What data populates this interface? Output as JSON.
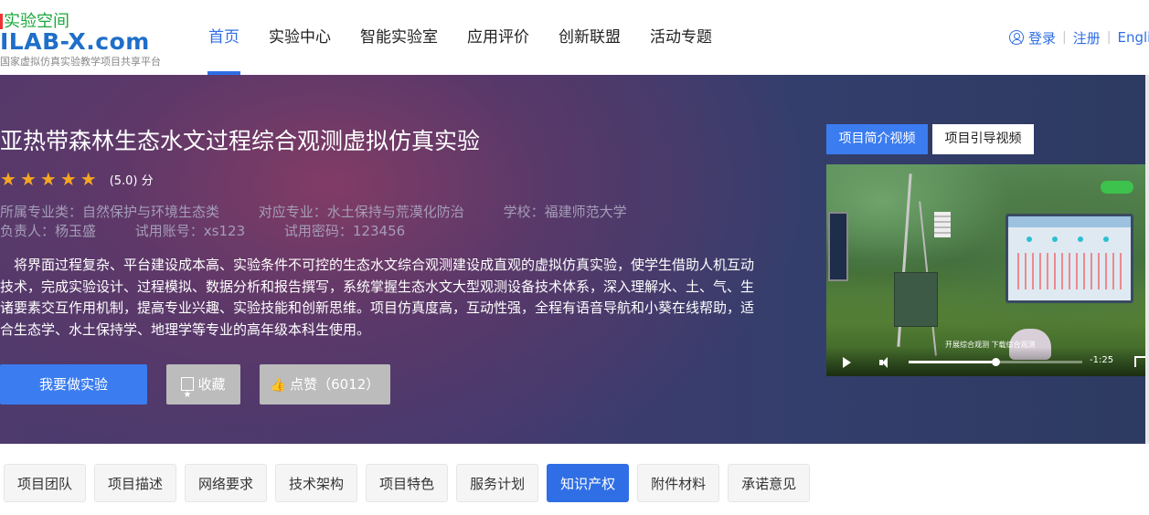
{
  "header": {
    "logo": {
      "top_text": "实验空间",
      "main_text": "ILAB-X.com",
      "subtitle": "国家虚拟仿真实验教学项目共享平台"
    },
    "nav": [
      {
        "label": "首页",
        "active": true
      },
      {
        "label": "实验中心",
        "active": false
      },
      {
        "label": "智能实验室",
        "active": false
      },
      {
        "label": "应用评价",
        "active": false
      },
      {
        "label": "创新联盟",
        "active": false
      },
      {
        "label": "活动专题",
        "active": false
      }
    ],
    "user": {
      "login": "登录",
      "register": "注册",
      "language": "Engli"
    }
  },
  "project": {
    "title": "亚热带森林生态水文过程综合观测虚拟仿真实验",
    "rating": {
      "stars": 5,
      "text": "(5.0) 分"
    },
    "meta_line1": [
      "所属专业类：自然保护与环境生态类",
      "对应专业：水土保持与荒漠化防治",
      "学校：福建师范大学"
    ],
    "meta_line2": [
      "负责人：杨玉盛",
      "试用账号：xs123",
      "试用密码：123456"
    ],
    "description": "　将界面过程复杂、平台建设成本高、实验条件不可控的生态水文综合观测建设成直观的虚拟仿真实验，使学生借助人机互动技术，完成实验设计、过程模拟、数据分析和报告撰写，系统掌握生态水文大型观测设备技术体系，深入理解水、土、气、生诸要素交互作用机制，提高专业兴趣、实验技能和创新思维。项目仿真度高，互动性强，全程有语音导航和小葵在线帮助，适合生态学、水土保持学、地理学等专业的高年级本科生使用。",
    "buttons": {
      "do_experiment": "我要做实验",
      "favorite": "收藏",
      "like": "点赞（6012）"
    }
  },
  "video": {
    "tabs": [
      {
        "label": "项目简介视频",
        "active": true
      },
      {
        "label": "项目引导视频",
        "active": false
      }
    ],
    "caption": "开展综合观测 下载综合观测",
    "time_remaining": "-1:25",
    "progress": 0.5
  },
  "detail_tabs": [
    {
      "label": "项目团队",
      "active": false
    },
    {
      "label": "项目描述",
      "active": false
    },
    {
      "label": "网络要求",
      "active": false
    },
    {
      "label": "技术架构",
      "active": false
    },
    {
      "label": "项目特色",
      "active": false
    },
    {
      "label": "服务计划",
      "active": false
    },
    {
      "label": "知识产权",
      "active": true
    },
    {
      "label": "附件材料",
      "active": false
    },
    {
      "label": "承诺意见",
      "active": false
    }
  ],
  "colors": {
    "accent": "#2f6ee5",
    "button_primary": "#3b7cf0",
    "star": "#f5a623",
    "button_gray": "#bcbcbc"
  }
}
